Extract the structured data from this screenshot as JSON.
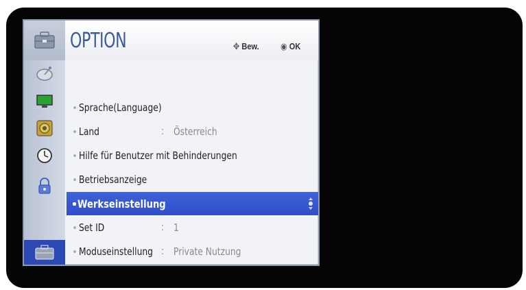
{
  "menu": {
    "title": "OPTION",
    "hints": {
      "move": "Bew.",
      "ok": "OK"
    },
    "sidebar_icons": [
      "satellite-dish-icon",
      "monitor-icon",
      "speaker-icon",
      "clock-icon",
      "lock-icon",
      "toolbox-icon"
    ],
    "items": [
      {
        "label": "Sprache(Language)",
        "value": ""
      },
      {
        "label": "Land",
        "value": "Österreich"
      },
      {
        "label": "Hilfe für Benutzer mit Behinderungen",
        "value": ""
      },
      {
        "label": "Betriebsanzeige",
        "value": ""
      },
      {
        "label": "Werkseinstellung",
        "value": ""
      },
      {
        "label": "Set ID",
        "value": "1"
      },
      {
        "label": "Moduseinstellung",
        "value": "Private Nutzung"
      }
    ],
    "selected_index": 4,
    "colors": {
      "accent": "#3a5aa0",
      "selection": "#2f4fc8",
      "sidebar_active": "#2b48b4"
    }
  }
}
